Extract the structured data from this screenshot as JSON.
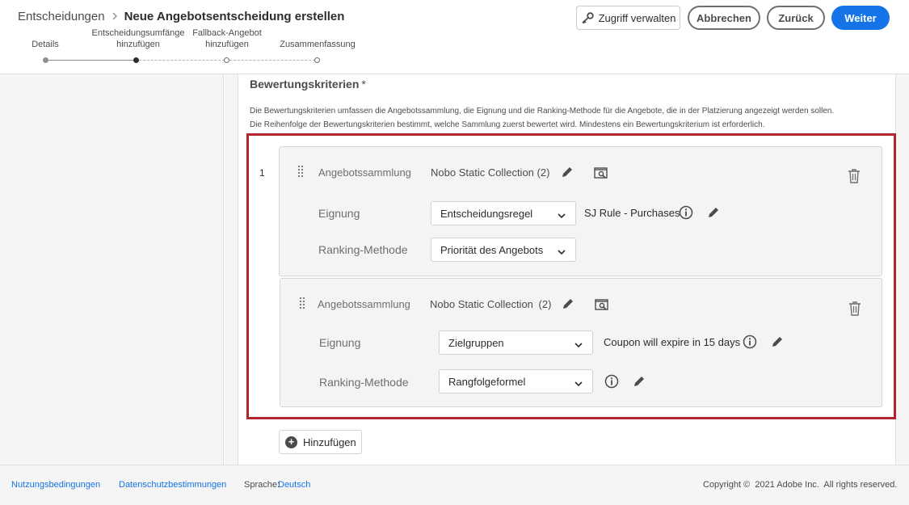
{
  "breadcrumb": {
    "parent": "Entscheidungen",
    "separator": ">",
    "current": "Neue Angebotsentscheidung erstellen"
  },
  "stepper": {
    "steps": [
      {
        "line1": "",
        "line2": "Details",
        "state": "done"
      },
      {
        "line1": "Entscheidungsumfänge",
        "line2": "hinzufügen",
        "state": "current"
      },
      {
        "line1": "Fallback-Angebot",
        "line2": "hinzufügen",
        "state": "next"
      },
      {
        "line1": "",
        "line2": "Zusammenfassung",
        "state": "next"
      }
    ]
  },
  "header_buttons": {
    "access": "Zugriff verwalten",
    "cancel": "Abbrechen",
    "back": "Zurück",
    "next": "Weiter"
  },
  "section": {
    "title": "Bewertungskriterien",
    "required_marker": "*",
    "description_1": "Die Bewertungskriterien umfassen die Angebotssammlung, die Eignung und die Ranking-Methode für die Angebote, die in der Platzierung angezeigt werden sollen.",
    "description_2": "Die Reihenfolge der Bewertungskriterien bestimmt, welche Sammlung zuerst bewertet wird. Mindestens ein Bewertungskriterium ist erforderlich."
  },
  "rank_number": "1",
  "cards": [
    {
      "collection_label": "Angebotssammlung",
      "collection_value": "Nobo Static Collection (2)",
      "eligibility_label": "Eignung",
      "eligibility_select": "Entscheidungsregel",
      "eligibility_value": "SJ Rule - Purchases",
      "ranking_label": "Ranking-Methode",
      "ranking_select": "Priorität des Angebots"
    },
    {
      "collection_label": "Angebotssammlung",
      "collection_value": "Nobo Static Collection",
      "collection_count": "(2)",
      "eligibility_label": "Eignung",
      "eligibility_select": "Zielgruppen",
      "eligibility_value": "Coupon will expire in 15 days",
      "ranking_label": "Ranking-Methode",
      "ranking_select": "Rangfolgeformel"
    }
  ],
  "add_button": "Hinzufügen",
  "footer": {
    "terms": "Nutzungsbedingungen",
    "privacy": "Datenschutzbestimmungen",
    "language_label": "Sprache:",
    "language_value": "Deutsch",
    "copyright": "Copyright ©  2021 Adobe Inc.  All rights reserved."
  },
  "colors": {
    "accent": "#1473e6",
    "highlight_border": "#b3252c"
  }
}
